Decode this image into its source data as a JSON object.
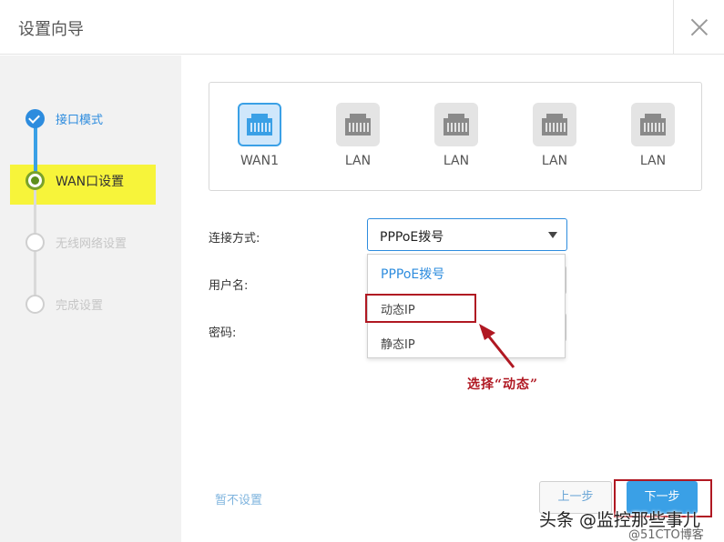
{
  "header": {
    "title": "设置向导"
  },
  "steps": [
    {
      "label": "接口模式",
      "state": "done"
    },
    {
      "label": "WAN口设置",
      "state": "current"
    },
    {
      "label": "无线网络设置",
      "state": "todo"
    },
    {
      "label": "完成设置",
      "state": "todo"
    }
  ],
  "ports": [
    {
      "label": "WAN1",
      "selected": true
    },
    {
      "label": "LAN",
      "selected": false
    },
    {
      "label": "LAN",
      "selected": false
    },
    {
      "label": "LAN",
      "selected": false
    },
    {
      "label": "LAN",
      "selected": false
    }
  ],
  "form": {
    "connection_label": "连接方式:",
    "connection_value": "PPPoE拨号",
    "username_label": "用户名:",
    "password_label": "密码:",
    "options": [
      "PPPoE拨号",
      "动态IP",
      "静态IP"
    ]
  },
  "annotation": "选择“动态”",
  "footer": {
    "skip_label": "暂不设置",
    "prev_label": "上一步",
    "next_label": "下一步"
  },
  "watermark": {
    "line1": "头条 @监控那些事儿",
    "line2": "@51CTO博客"
  },
  "colors": {
    "accent": "#2d8cde",
    "button_blue": "#3aa0e6",
    "highlight": "#f7f43a",
    "annotation_red": "#b01822"
  },
  "icons": {
    "close": "close-icon",
    "port": "ethernet-port-icon",
    "check": "check-icon",
    "dropdown": "chevron-down-icon"
  }
}
